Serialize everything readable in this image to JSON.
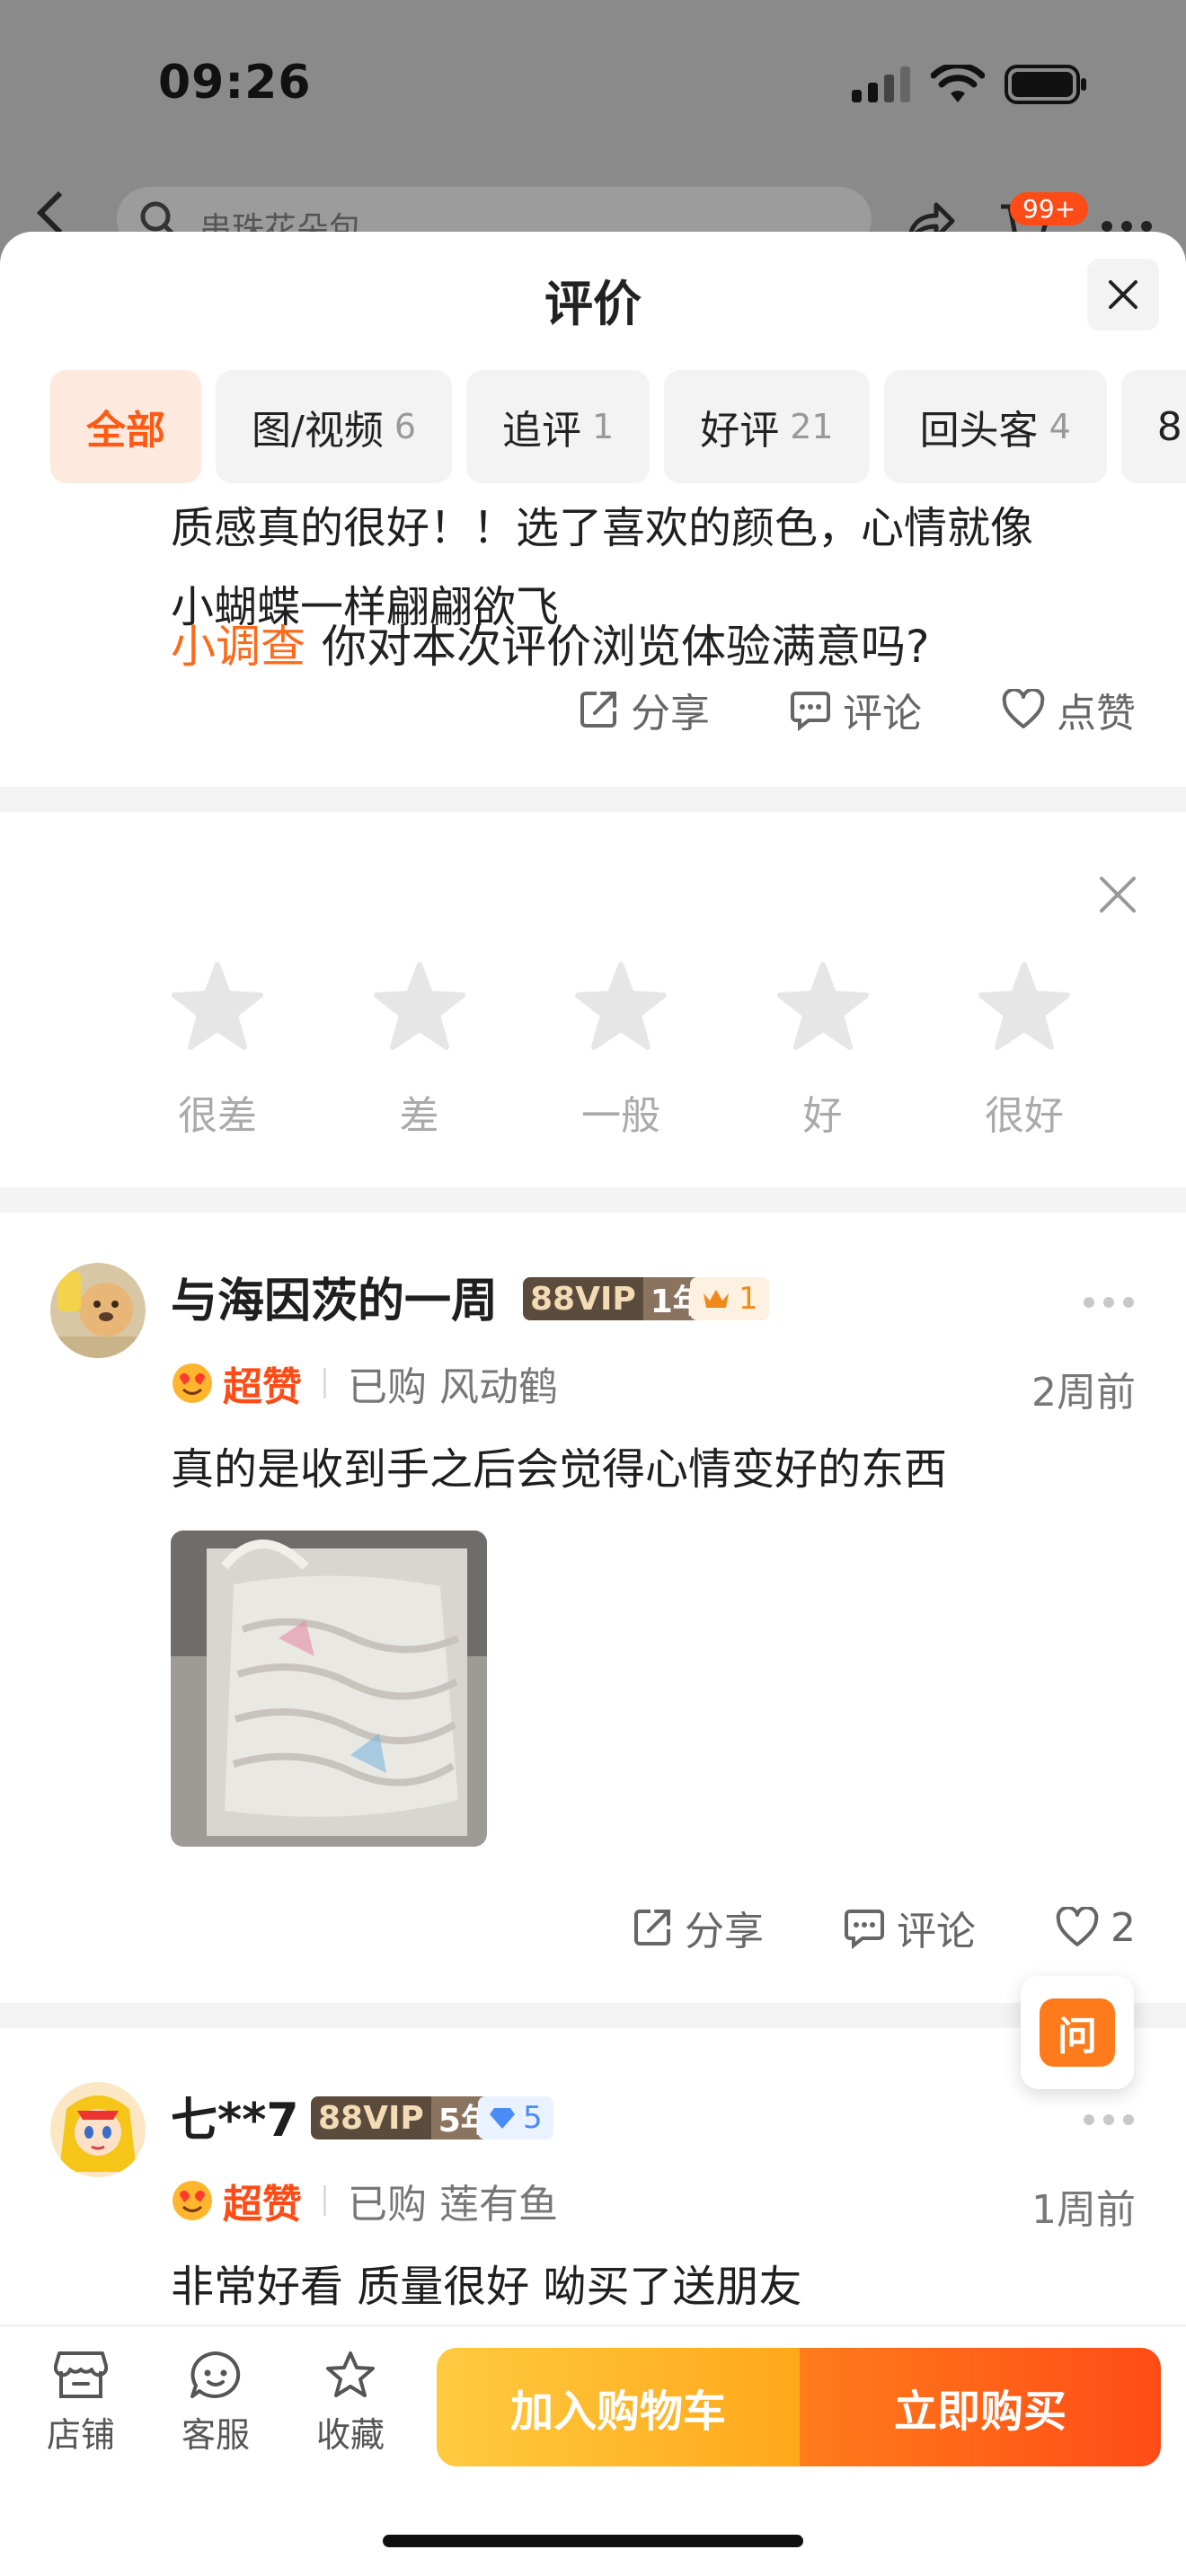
{
  "status_bar": {
    "time": "09:26"
  },
  "background_header": {
    "search_placeholder": "串珠花朵包",
    "cart_badge": "99+"
  },
  "sheet": {
    "title": "评价"
  },
  "tabs": [
    {
      "label": "全部",
      "count": ""
    },
    {
      "label": "图/视频",
      "count": "6"
    },
    {
      "label": "追评",
      "count": "1"
    },
    {
      "label": "好评",
      "count": "21"
    },
    {
      "label": "回头客",
      "count": "4"
    },
    {
      "label": "8",
      "count": ""
    }
  ],
  "review_fragment": {
    "text_line1": "质感真的很好！！选了喜欢的颜色，心情就像",
    "text_line2": "小蝴蝶一样翩翩欲飞",
    "share": "分享",
    "comment": "评论",
    "like": "点赞"
  },
  "survey": {
    "label": "小调查",
    "question": "你对本次评价浏览体验满意吗?",
    "options": [
      "很差",
      "差",
      "一般",
      "好",
      "很好"
    ]
  },
  "reviews": [
    {
      "username": "与海因茨的一周",
      "vip": "88VIP",
      "vip_years": "1年",
      "level": "1",
      "level_color": "#f5a623",
      "rating": "超赞",
      "purchased_label": "已购",
      "variant": "风动鹤",
      "time": "2周前",
      "text": "真的是收到手之后会觉得心情变好的东西",
      "share": "分享",
      "comment": "评论",
      "likes": "2",
      "avatar_text": "快乐小狗"
    },
    {
      "username": "七**7",
      "vip": "88VIP",
      "vip_years": "5年",
      "level": "5",
      "level_color": "#4a8cf7",
      "rating": "超赞",
      "purchased_label": "已购",
      "variant": "莲有鱼",
      "time": "1周前",
      "text": "非常好看 质量很好 呦买了送朋友"
    }
  ],
  "ask_button": {
    "label": "问"
  },
  "bottom_bar": {
    "store": "店铺",
    "service": "客服",
    "favorite": "收藏",
    "add_to_cart": "加入购物车",
    "buy_now": "立即购买"
  },
  "colors": {
    "accent": "#ff5a14",
    "star_gray": "#e6e6e6"
  }
}
